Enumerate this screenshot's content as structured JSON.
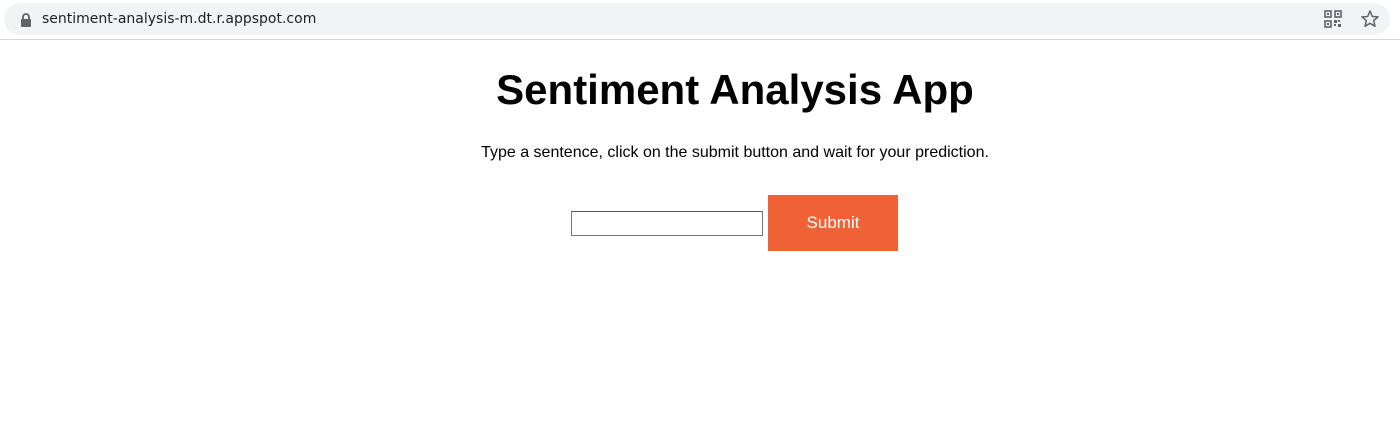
{
  "browser": {
    "url": "sentiment-analysis-m.dt.r.appspot.com",
    "icons": [
      "lock-icon",
      "qr-code-icon",
      "star-icon"
    ]
  },
  "page": {
    "title": "Sentiment Analysis App",
    "instructions": "Type a sentence, click on the submit button and wait for your prediction.",
    "sentence_input": {
      "value": "",
      "placeholder": ""
    },
    "submit_label": "Submit"
  },
  "colors": {
    "submit_background": "#f06236",
    "submit_text": "#ffffff",
    "omnibox_background": "#f1f3f4"
  }
}
